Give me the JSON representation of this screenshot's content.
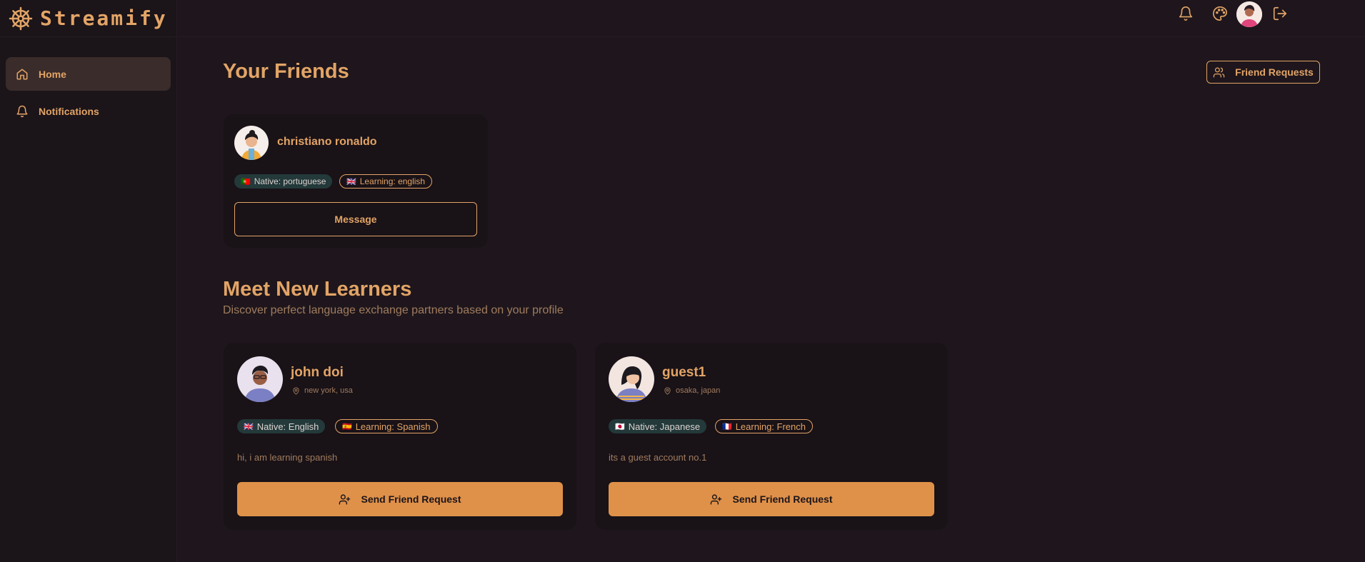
{
  "app": {
    "name": "Streamify"
  },
  "sidebar": {
    "items": [
      {
        "label": "Home",
        "icon": "home-icon",
        "active": true
      },
      {
        "label": "Notifications",
        "icon": "bell-icon",
        "active": false
      }
    ]
  },
  "topbar": {
    "icons": [
      "bell-icon",
      "palette-icon",
      "avatar",
      "logout-icon"
    ]
  },
  "friends_section": {
    "title": "Your Friends",
    "requests_button": "Friend Requests",
    "friends": [
      {
        "name": "christiano ronaldo",
        "native_flag": "🇵🇹",
        "native": "Native: portuguese",
        "learning_flag": "🇬🇧",
        "learning": "Learning: english",
        "button": "Message"
      }
    ]
  },
  "learners_section": {
    "title": "Meet New Learners",
    "subtitle": "Discover perfect language exchange partners based on your profile",
    "learners": [
      {
        "name": "john doi",
        "location": "new york, usa",
        "native_flag": "🇬🇧",
        "native": "Native: English",
        "learning_flag": "🇪🇸",
        "learning": "Learning: Spanish",
        "bio": "hi, i am learning spanish",
        "button": "Send Friend Request"
      },
      {
        "name": "guest1",
        "location": "osaka, japan",
        "native_flag": "🇯🇵",
        "native": "Native: Japanese",
        "learning_flag": "🇫🇷",
        "learning": "Learning: French",
        "bio": "its a guest account no.1",
        "button": "Send Friend Request"
      }
    ]
  },
  "colors": {
    "background": "#1e161c",
    "accent": "#e2a466",
    "button_fill": "#df9149",
    "native_badge": "#23393a"
  }
}
